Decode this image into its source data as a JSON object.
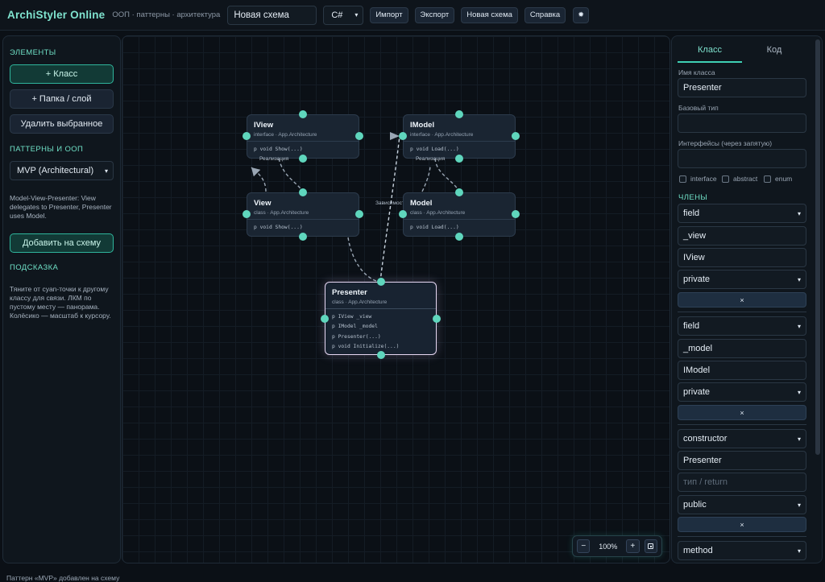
{
  "header": {
    "app_title": "ArchiStyler Online",
    "app_subtitle": "ООП · паттерны · архитектура",
    "schema_name": "Новая схема",
    "language": "C#",
    "buttons": {
      "import": "Импорт",
      "export": "Экспорт",
      "new_schema": "Новая схема",
      "help": "Справка"
    },
    "theme_icon": "sun-icon"
  },
  "left_panel": {
    "elements_title": "ЭЛЕМЕНТЫ",
    "add_class": "+ Класс",
    "add_folder": "+ Папка / слой",
    "delete_selected": "Удалить выбранное",
    "patterns_title": "ПАТТЕРНЫ И ООП",
    "pattern_selected": "MVP (Architectural)",
    "pattern_description": "Model-View-Presenter: View delegates to Presenter, Presenter uses Model.",
    "add_to_schema": "Добавить на схему",
    "hint_title": "ПОДСКАЗКА",
    "hint_text": "Тяните от cyan-точки к другому классу для связи. ЛКМ по пустому месту — панорама. Колёсико — масштаб к курсору."
  },
  "canvas": {
    "nodes": [
      {
        "name": "IView",
        "sub": "interface · App.Architecture",
        "members": [
          "p void Show(...)"
        ]
      },
      {
        "name": "IModel",
        "sub": "interface · App.Architecture",
        "members": [
          "p void Load(...)"
        ]
      },
      {
        "name": "View",
        "sub": "class · App.Architecture",
        "members": [
          "p void Show(...)"
        ]
      },
      {
        "name": "Model",
        "sub": "class · App.Architecture",
        "members": [
          "p void Load(...)"
        ]
      },
      {
        "name": "Presenter",
        "sub": "class · App.Architecture",
        "members": [
          "p IView _view",
          "p IModel _model",
          "p Presenter(...)",
          "p void Initialize(...)"
        ]
      }
    ],
    "edge_labels": {
      "realization_left": "Реализация",
      "realization_right": "Реализация",
      "dependency": "Зависимость"
    },
    "zoom": {
      "value": "100%",
      "minus": "−",
      "plus": "+"
    }
  },
  "right_panel": {
    "tabs": [
      "Класс",
      "Код"
    ],
    "class_name_label": "Имя класса",
    "class_name": "Presenter",
    "base_type_label": "Базовый тип",
    "base_type": "",
    "interfaces_label": "Интерфейсы (через запятую)",
    "interfaces": "",
    "checkboxes": [
      "interface",
      "abstract",
      "enum"
    ],
    "members_title": "ЧЛЕНЫ",
    "members": [
      {
        "kind": "field",
        "name": "_view",
        "type": "IView",
        "access": "private"
      },
      {
        "kind": "field",
        "name": "_model",
        "type": "IModel",
        "access": "private"
      },
      {
        "kind": "constructor",
        "name": "Presenter",
        "type_placeholder": "тип / return",
        "access": "public"
      }
    ],
    "next_member_kind": "method",
    "delete_symbol": "×"
  },
  "status": "Паттерн «MVP» добавлен на схему"
}
